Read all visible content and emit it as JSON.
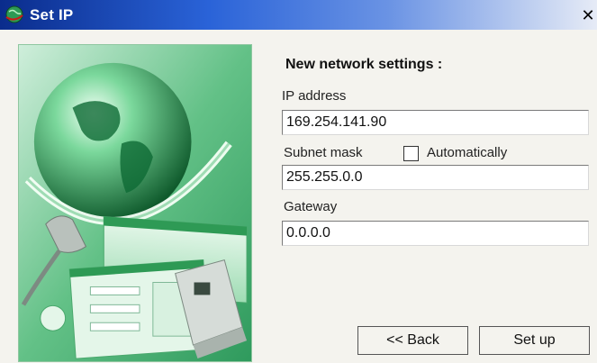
{
  "window": {
    "title": "Set IP",
    "close_glyph": "✕"
  },
  "form": {
    "heading": "New network settings :",
    "ip": {
      "label": "IP address",
      "value": "169.254.141.90"
    },
    "subnet": {
      "label": "Subnet mask",
      "value": "255.255.0.0",
      "auto_label": "Automatically",
      "auto_checked": false
    },
    "gateway": {
      "label": "Gateway",
      "value": "0.0.0.0"
    }
  },
  "buttons": {
    "back": "<< Back",
    "setup": "Set up"
  },
  "icons": {
    "app": "network-globe-icon",
    "close": "close-icon"
  },
  "colors": {
    "titlebar_start": "#0a2c8c",
    "titlebar_end": "#e6ebf6",
    "art_green": "#3fae6a",
    "dialog_bg": "#f4f3ee"
  }
}
